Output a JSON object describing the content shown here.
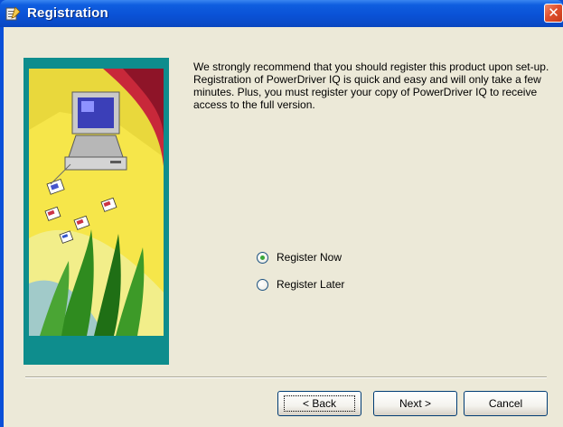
{
  "window": {
    "title": "Registration",
    "title_icon": "registration-app-icon",
    "close_glyph": "✕"
  },
  "intro_text": "We strongly recommend that you should register this product upon set-up.  Registration of PowerDriver IQ is quick and easy and will only take a few minutes.  Plus, you must register your copy of PowerDriver IQ to receive access to the full version.",
  "options": [
    {
      "label": "Register Now",
      "selected": true
    },
    {
      "label": "Register Later",
      "selected": false
    }
  ],
  "buttons": {
    "back": "< Back",
    "next": "Next >",
    "cancel": "Cancel"
  },
  "colors": {
    "titlebar": "#0a52d6",
    "dialog_background": "#ece9d8",
    "side_panel": "#0e8d8d"
  }
}
